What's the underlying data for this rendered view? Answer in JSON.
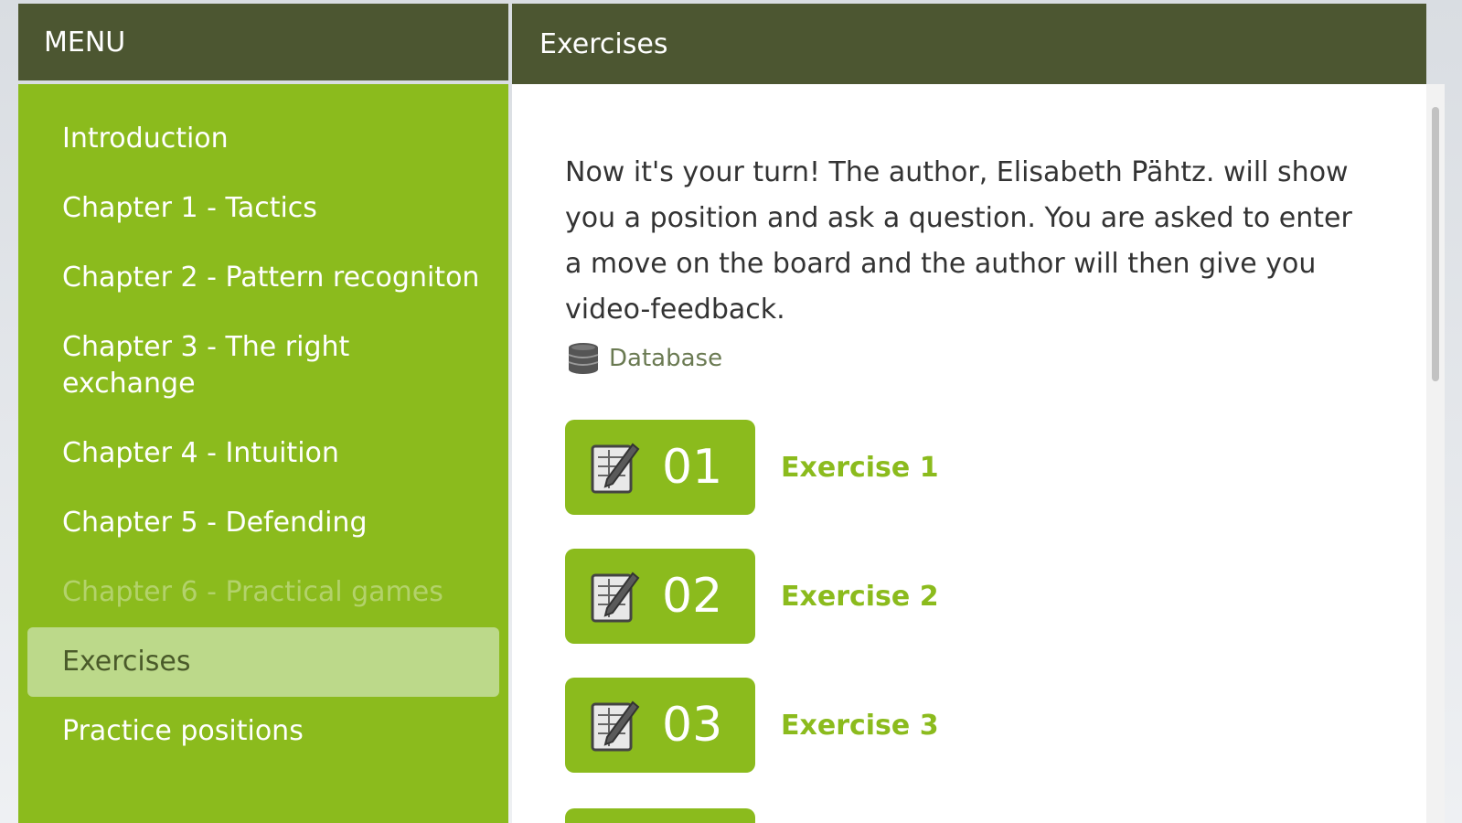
{
  "menu": {
    "title": "MENU",
    "items": [
      {
        "label": "Introduction"
      },
      {
        "label": "Chapter 1 - Tactics"
      },
      {
        "label": "Chapter 2 - Pattern recogniton"
      },
      {
        "label": "Chapter 3 - The right exchange"
      },
      {
        "label": "Chapter 4 - Intuition"
      },
      {
        "label": "Chapter 5 - Defending"
      },
      {
        "label": "Chapter 6 - Practical games"
      },
      {
        "label": "Exercises"
      },
      {
        "label": "Practice positions"
      }
    ]
  },
  "content": {
    "title": "Exercises",
    "intro": "Now it's your turn! The author, Elisabeth Pähtz. will show you a position and ask a question. You are asked to enter a move on the board and the author will then give you video-feedback.",
    "database_label": "Database",
    "exercises": [
      {
        "number": "01",
        "label": "Exercise 1"
      },
      {
        "number": "02",
        "label": "Exercise 2"
      },
      {
        "number": "03",
        "label": "Exercise 3"
      }
    ]
  },
  "colors": {
    "header": "#4c5631",
    "accent": "#8bbb1d",
    "active_item": "#bcd98a"
  }
}
